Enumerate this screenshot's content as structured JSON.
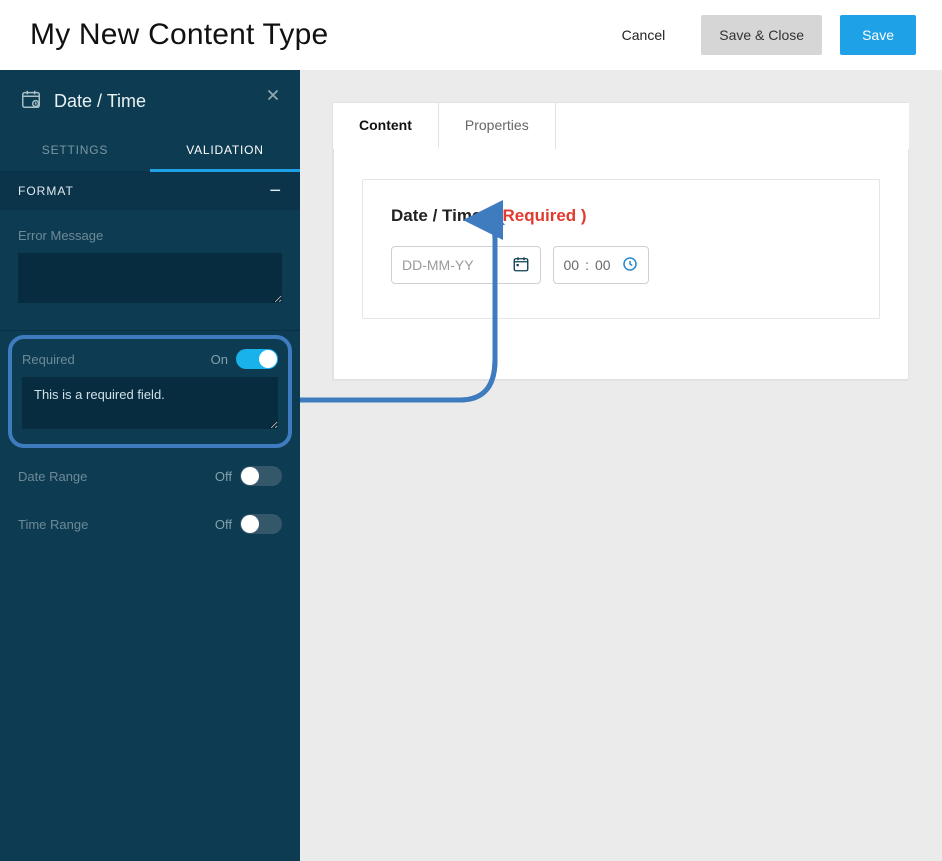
{
  "header": {
    "title": "My New Content Type",
    "cancel": "Cancel",
    "save_close": "Save & Close",
    "save": "Save"
  },
  "sidebar": {
    "title": "Date / Time",
    "tabs": {
      "settings": "SETTINGS",
      "validation": "VALIDATION"
    },
    "format_label": "FORMAT",
    "error_msg_label": "Error Message",
    "error_msg_value": "",
    "required": {
      "label": "Required",
      "state": "On",
      "msg": "This is a required field."
    },
    "date_range": {
      "label": "Date Range",
      "state": "Off"
    },
    "time_range": {
      "label": "Time Range",
      "state": "Off"
    }
  },
  "canvas": {
    "tabs": {
      "content": "Content",
      "properties": "Properties"
    },
    "field": {
      "label": "Date / Time",
      "required_text": "( Required )",
      "date_placeholder": "DD-MM-YY",
      "time_hh": "00",
      "time_sep": ":",
      "time_mm": "00"
    }
  }
}
